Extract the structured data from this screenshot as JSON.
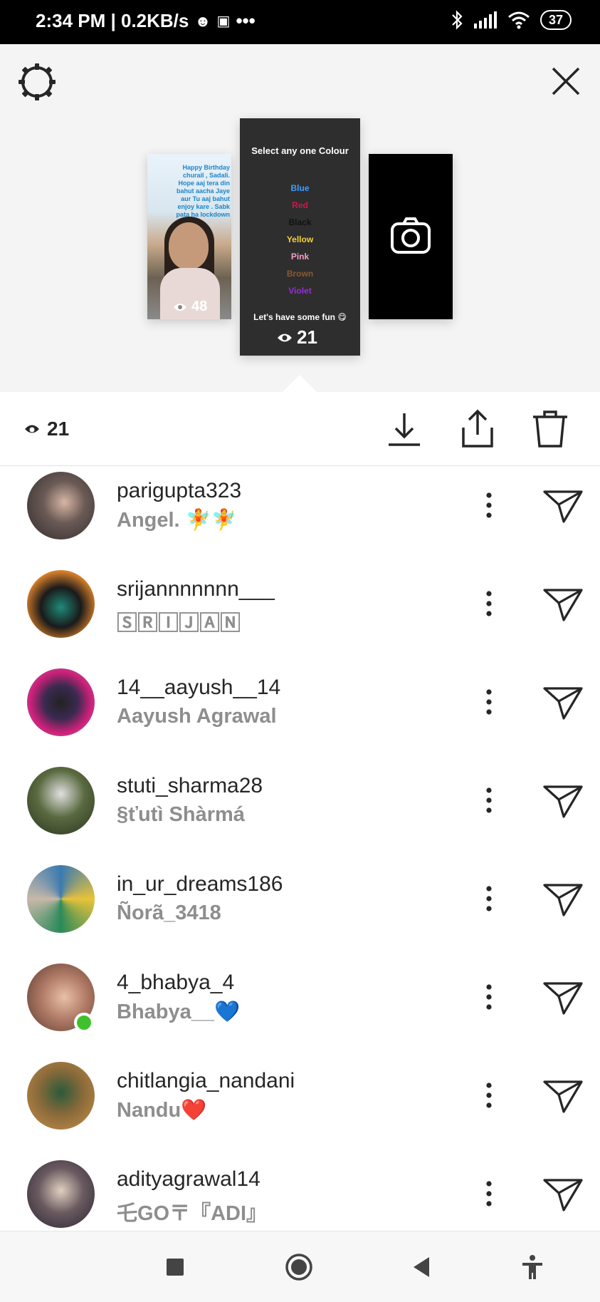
{
  "status_bar": {
    "time_speed": "2:34 PM | 0.2KB/s",
    "dots": "•••",
    "battery": "37"
  },
  "story": {
    "left_thumb": {
      "caption": "Happy Birthday churail , Sadali. Hope aaj tera din bahut aacha Jaye aur Tu aaj bahut enjoy kare . Sabk pata ha lockdown",
      "views": "48"
    },
    "center_thumb": {
      "title": "Select any one Colour",
      "colors": [
        {
          "label": "Blue",
          "color": "#3ea0ff"
        },
        {
          "label": "Red",
          "color": "#d0164a"
        },
        {
          "label": "Black",
          "color": "#111111"
        },
        {
          "label": "Yellow",
          "color": "#f3d23a"
        },
        {
          "label": "Pink",
          "color": "#f59ec6"
        },
        {
          "label": "Brown",
          "color": "#8a5a2e"
        },
        {
          "label": "Violet",
          "color": "#9a2bd9"
        }
      ],
      "footer": "Let's have some fun 😋",
      "views": "21"
    }
  },
  "toolbar": {
    "viewer_count": "21"
  },
  "viewers": [
    {
      "username": "parigupta323",
      "fullname": "Angel. 🧚🧚",
      "avatar_color": "#3a3030",
      "online": false
    },
    {
      "username": "srijannnnnnn___",
      "fullname": "🅂🅁🄸🄹🄰🄽",
      "avatar_color": "#2a2418",
      "online": false
    },
    {
      "username": "14__aayush__14",
      "fullname": "Aayush Agrawal",
      "avatar_color": "#7a2a6a",
      "online": false
    },
    {
      "username": "stuti_sharma28",
      "fullname": "§ťutì Shàrmá",
      "avatar_color": "#4c5a3a",
      "online": false
    },
    {
      "username": "in_ur_dreams186",
      "fullname": "Ñorã_3418",
      "avatar_color": "#5a8aa6",
      "online": false
    },
    {
      "username": "4_bhabya_4",
      "fullname": "Bhabya__💙",
      "avatar_color": "#b07a66",
      "online": true
    },
    {
      "username": "chitlangia_nandani",
      "fullname": "Nandu❤️",
      "avatar_color": "#6a5a3a",
      "online": false
    },
    {
      "username": "adityagrawal14",
      "fullname": "乇GO〒『ADI』",
      "avatar_color": "#4a4450",
      "online": false
    }
  ]
}
